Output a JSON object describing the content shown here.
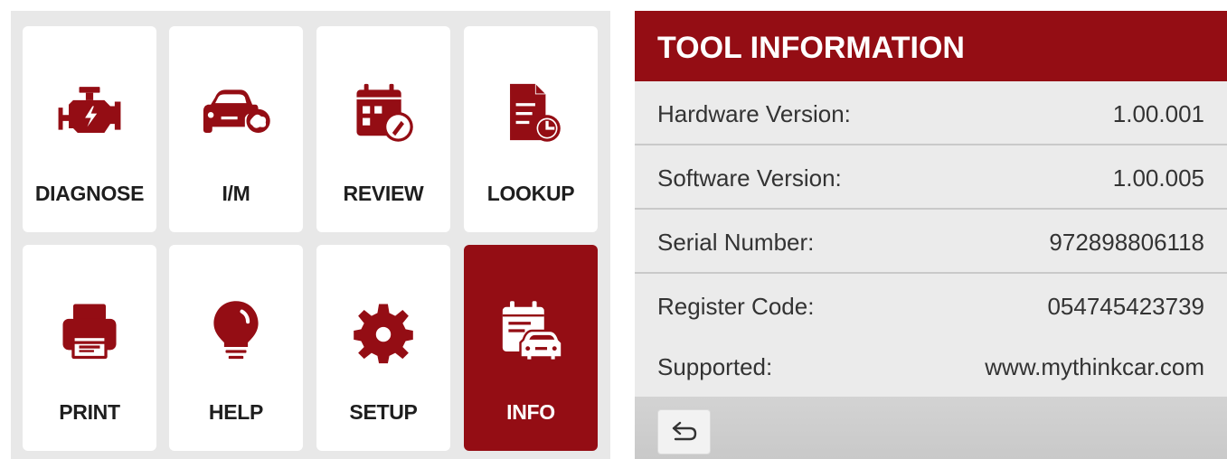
{
  "menu": {
    "accent_color": "#940d14",
    "tiles": [
      {
        "label": "DIAGNOSE",
        "icon": "engine-icon",
        "active": false
      },
      {
        "label": "I/M",
        "icon": "car-emission-icon",
        "active": false
      },
      {
        "label": "REVIEW",
        "icon": "calendar-edit-icon",
        "active": false
      },
      {
        "label": "LOOKUP",
        "icon": "document-clock-icon",
        "active": false
      },
      {
        "label": "PRINT",
        "icon": "printer-icon",
        "active": false
      },
      {
        "label": "HELP",
        "icon": "lightbulb-icon",
        "active": false
      },
      {
        "label": "SETUP",
        "icon": "gear-icon",
        "active": false
      },
      {
        "label": "INFO",
        "icon": "calendar-car-icon",
        "active": true
      }
    ]
  },
  "info": {
    "title": "TOOL INFORMATION",
    "rows": [
      {
        "label": "Hardware Version:",
        "value": "1.00.001"
      },
      {
        "label": "Software Version:",
        "value": "1.00.005"
      },
      {
        "label": "Serial Number:",
        "value": "972898806118"
      },
      {
        "label": "Register Code:",
        "value": "054745423739"
      },
      {
        "label": "Supported:",
        "value": "www.mythinkcar.com"
      }
    ],
    "footer": {
      "back_icon": "back-arrow-icon"
    }
  }
}
